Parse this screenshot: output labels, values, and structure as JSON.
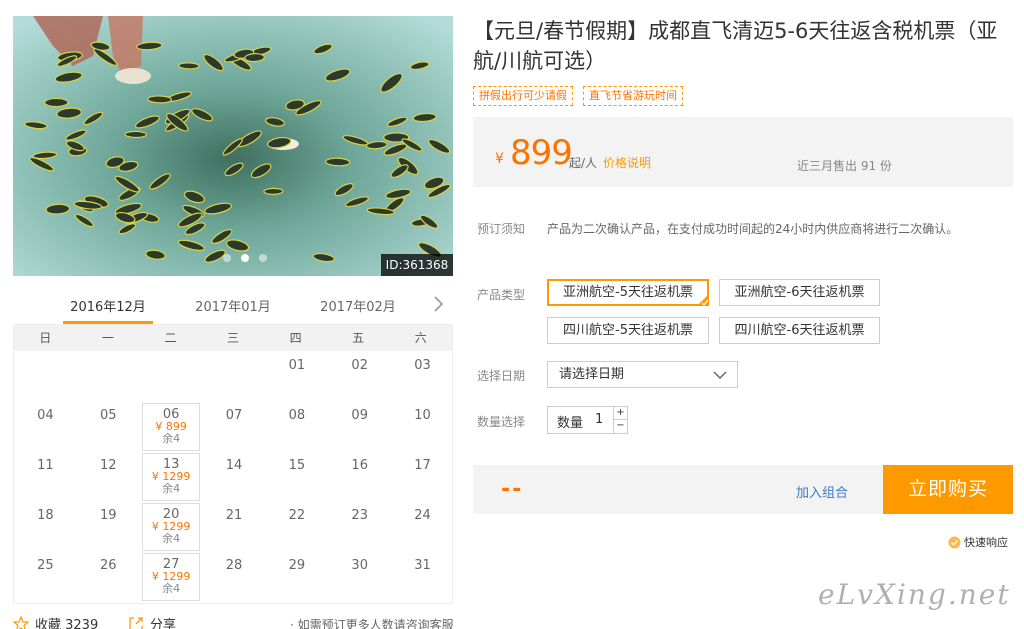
{
  "product": {
    "title": "【元旦/春节假期】成都直飞清迈5-6天往返含税机票（亚航/川航可选）",
    "tags": [
      "拼假出行可少请假",
      "直飞节省游玩时间"
    ],
    "image_id": "ID:361368",
    "carousel": {
      "count": 3,
      "active": 2
    }
  },
  "price": {
    "currency": "¥",
    "amount": "899",
    "unit": "起/人",
    "explain_link": "价格说明",
    "sold": "近三月售出 91 份"
  },
  "booking_notice": {
    "label": "预订须知",
    "text": "产品为二次确认产品，在支付成功时间起的24小时内供应商将进行二次确认。"
  },
  "product_type": {
    "label": "产品类型",
    "options": [
      "亚洲航空-5天往返机票",
      "亚洲航空-6天往返机票",
      "四川航空-5天往返机票",
      "四川航空-6天往返机票"
    ],
    "selected": 0
  },
  "date_select": {
    "label": "选择日期",
    "placeholder": "请选择日期"
  },
  "quantity": {
    "label": "数量选择",
    "field_label": "数量",
    "value": "1",
    "plus": "+",
    "minus": "−"
  },
  "buy": {
    "total": "--",
    "combo_link": "加入组合",
    "buy_button": "立即购买",
    "fast_response": "快速响应"
  },
  "calendar": {
    "months": [
      "2016年12月",
      "2017年01月",
      "2017年02月"
    ],
    "active_month": 0,
    "weekdays": [
      "日",
      "一",
      "二",
      "三",
      "四",
      "五",
      "六"
    ],
    "first_weekday": 4,
    "days_in_month": 31,
    "available": [
      {
        "day": 6,
        "price": "¥ 899",
        "stock": "余4"
      },
      {
        "day": 13,
        "price": "¥ 1299",
        "stock": "余4"
      },
      {
        "day": 20,
        "price": "¥ 1299",
        "stock": "余4"
      },
      {
        "day": 27,
        "price": "¥ 1299",
        "stock": "余4"
      }
    ]
  },
  "footer": {
    "favorite": "收藏 3239",
    "share": "分享",
    "consult": "· 如需预订更多人数请咨询客服"
  },
  "watermark": "eLvXing.net",
  "colors": {
    "accent": "#ff9900",
    "price": "#ff7200",
    "link": "#3a7ac9"
  }
}
